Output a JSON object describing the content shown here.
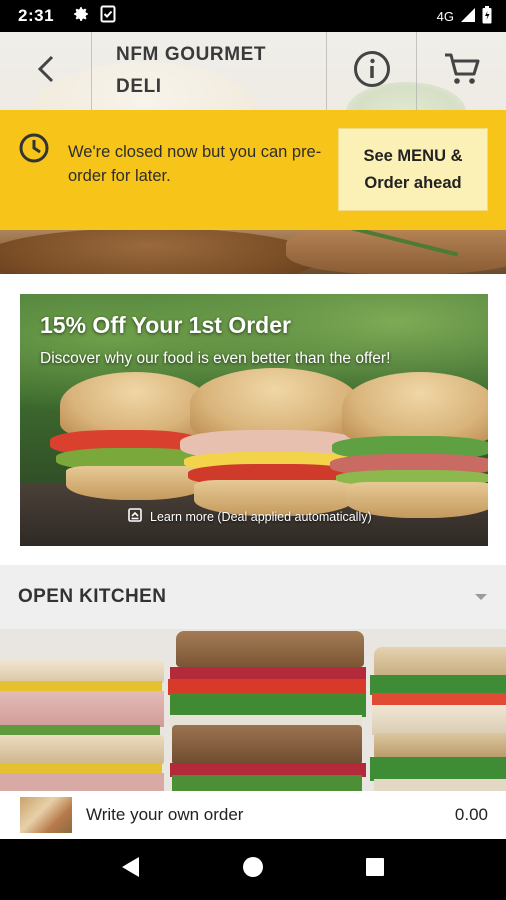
{
  "status_bar": {
    "time": "2:31",
    "network": "4G"
  },
  "header": {
    "title_line1": "NFM GOURMET",
    "title_line2": "DELI"
  },
  "banner": {
    "message": "We're closed now but you can pre-order for later.",
    "button_line1": "See MENU &",
    "button_line2": "Order ahead"
  },
  "promo": {
    "title": "15% Off Your 1st Order",
    "subtitle": "Discover why our food is even better than the offer!",
    "learn_more": "Learn more (Deal applied automatically)"
  },
  "section": {
    "title": "OPEN KITCHEN"
  },
  "order_item": {
    "label": "Write your own order",
    "price": "0.00"
  },
  "colors": {
    "banner": "#f7c519",
    "banner_button": "#fbf0b5",
    "section_bg": "#efefef"
  },
  "icons": [
    "settings-icon",
    "document-icon",
    "signal-icon",
    "battery-icon",
    "back-arrow-icon",
    "info-icon",
    "cart-icon",
    "clock-icon",
    "learn-more-icon",
    "chevron-down-icon",
    "nav-back-icon",
    "nav-home-icon",
    "nav-recents-icon"
  ]
}
